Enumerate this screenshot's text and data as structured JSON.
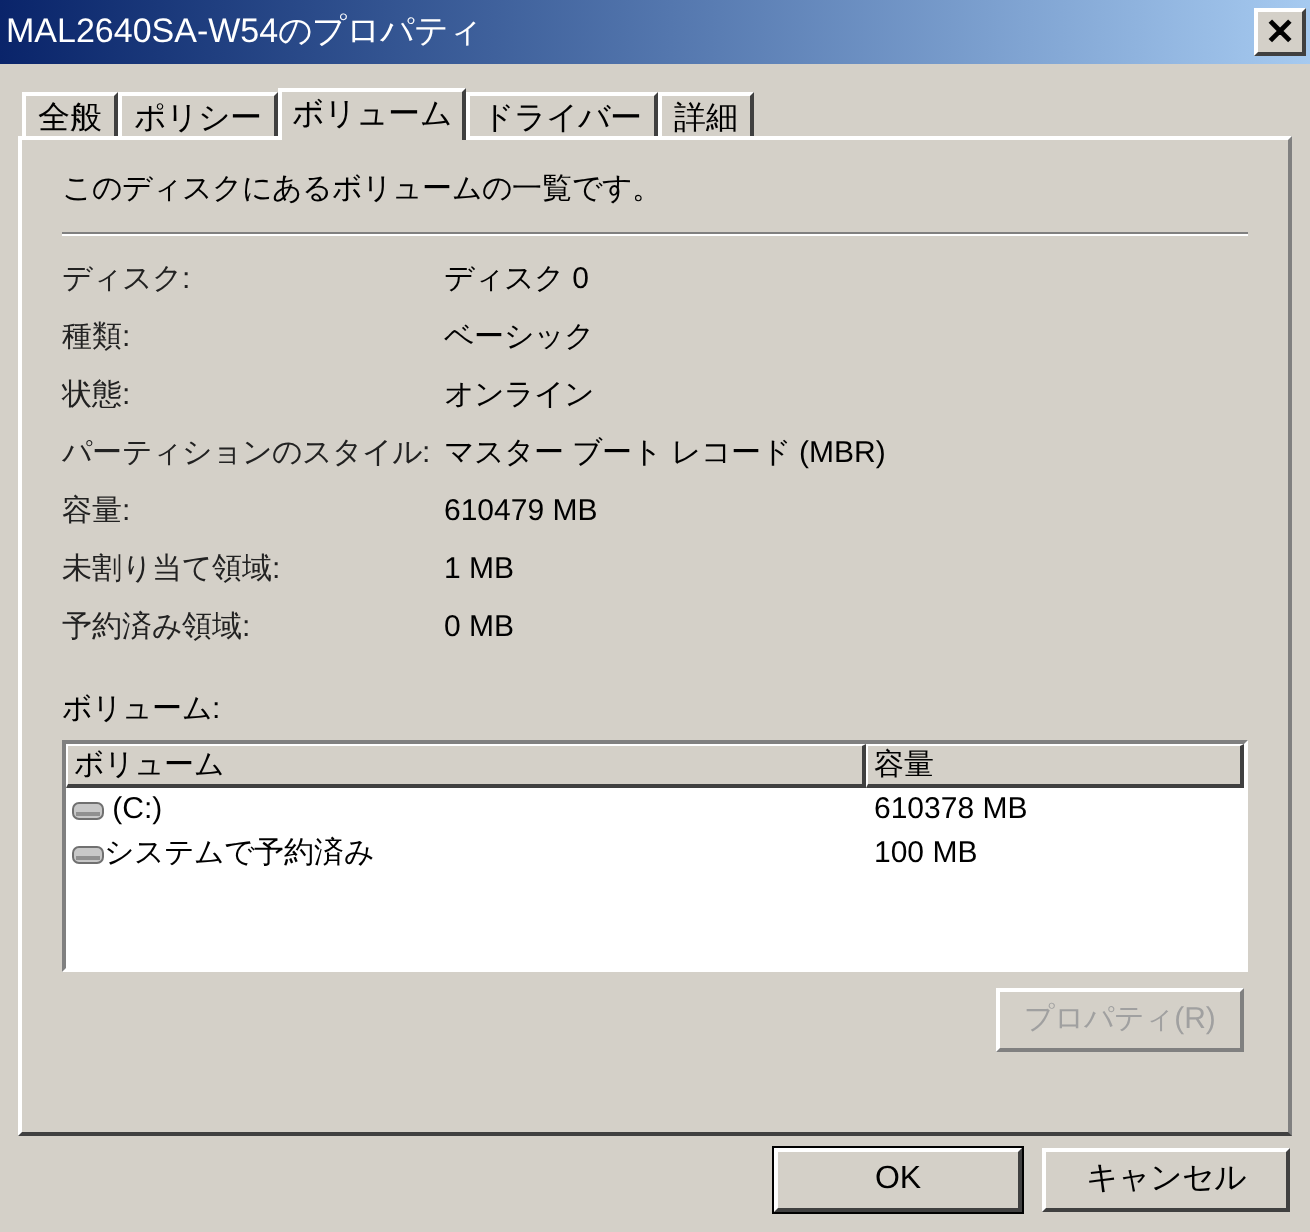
{
  "window": {
    "title": "MAL2640SA-W54のプロパティ",
    "close": "✕"
  },
  "tabs": [
    {
      "label": "全般",
      "selected": false
    },
    {
      "label": "ポリシー",
      "selected": false
    },
    {
      "label": "ボリューム",
      "selected": true
    },
    {
      "label": "ドライバー",
      "selected": false
    },
    {
      "label": "詳細",
      "selected": false
    }
  ],
  "description": "このディスクにあるボリュームの一覧です。",
  "properties": [
    {
      "label": "ディスク:",
      "value": "ディスク 0"
    },
    {
      "label": "種類:",
      "value": "ベーシック"
    },
    {
      "label": "状態:",
      "value": "オンライン"
    },
    {
      "label": "パーティションのスタイル:",
      "value": "マスター ブート レコード (MBR)"
    },
    {
      "label": "容量:",
      "value": "610479 MB"
    },
    {
      "label": "未割り当て領域:",
      "value": "1 MB"
    },
    {
      "label": "予約済み領域:",
      "value": "0 MB"
    }
  ],
  "volumes": {
    "label": "ボリューム:",
    "columns": [
      "ボリューム",
      "容量"
    ],
    "rows": [
      {
        "volume": " (C:)",
        "capacity": "610378 MB"
      },
      {
        "volume": "システムで予約済み",
        "capacity": "100 MB"
      }
    ]
  },
  "properties_button": {
    "label": "プロパティ(R)",
    "disabled": true
  },
  "buttons": [
    "OK",
    "キャンセル"
  ]
}
